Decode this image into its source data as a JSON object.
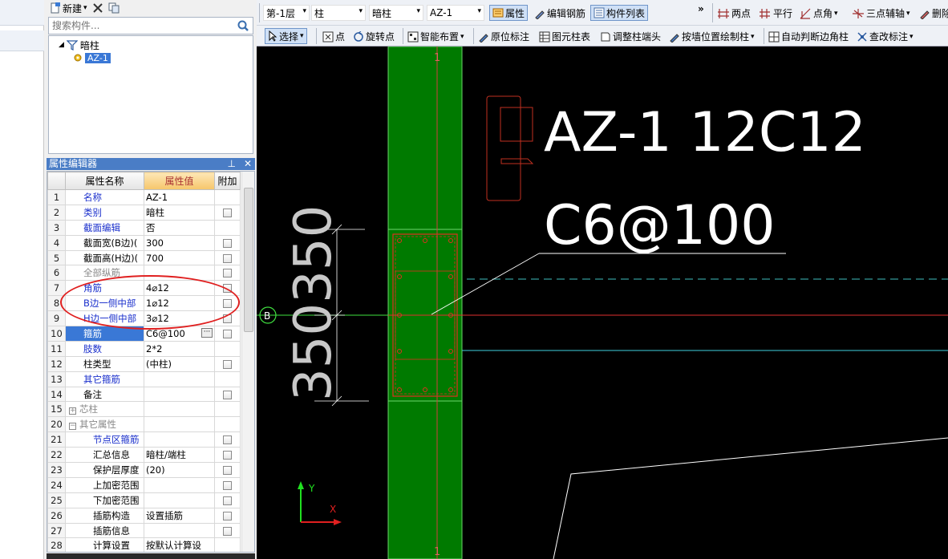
{
  "panel_toolbar": {
    "new_label": "新建",
    "new_arrow": "▾"
  },
  "search": {
    "placeholder": "搜索构件..."
  },
  "tree": {
    "root_label": "暗柱",
    "child_label": "AZ-1"
  },
  "prop_editor": {
    "title": "属性编辑器",
    "col_name": "属性名称",
    "col_value": "属性值",
    "col_extra": "附加",
    "rows": [
      {
        "num": "1",
        "name": "名称",
        "value": "AZ-1"
      },
      {
        "num": "2",
        "name": "类别",
        "value": "暗柱"
      },
      {
        "num": "3",
        "name": "截面编辑",
        "value": "否"
      },
      {
        "num": "4",
        "name": "截面宽(B边)(",
        "value": "300"
      },
      {
        "num": "5",
        "name": "截面高(H边)(",
        "value": "700"
      },
      {
        "num": "6",
        "name": "全部纵筋",
        "value": ""
      },
      {
        "num": "7",
        "name": "角筋",
        "value": "4⌀12"
      },
      {
        "num": "8",
        "name": "B边一侧中部",
        "value": "1⌀12"
      },
      {
        "num": "9",
        "name": "H边一侧中部",
        "value": "3⌀12"
      },
      {
        "num": "10",
        "name": "箍筋",
        "value": "C6@100"
      },
      {
        "num": "11",
        "name": "肢数",
        "value": "2*2"
      },
      {
        "num": "12",
        "name": "柱类型",
        "value": "(中柱)"
      },
      {
        "num": "13",
        "name": "其它箍筋",
        "value": ""
      },
      {
        "num": "14",
        "name": "备注",
        "value": ""
      },
      {
        "num": "15",
        "name": "芯柱",
        "value": ""
      },
      {
        "num": "20",
        "name": "其它属性",
        "value": ""
      },
      {
        "num": "21",
        "name": "节点区箍筋",
        "value": ""
      },
      {
        "num": "22",
        "name": "汇总信息",
        "value": "暗柱/端柱"
      },
      {
        "num": "23",
        "name": "保护层厚度",
        "value": "(20)"
      },
      {
        "num": "24",
        "name": "上加密范围",
        "value": ""
      },
      {
        "num": "25",
        "name": "下加密范围",
        "value": ""
      },
      {
        "num": "26",
        "name": "插筋构造",
        "value": "设置插筋"
      },
      {
        "num": "27",
        "name": "插筋信息",
        "value": ""
      },
      {
        "num": "28",
        "name": "计算设置",
        "value": "按默认计算设"
      }
    ]
  },
  "toolbar1": {
    "floor": "第-1层",
    "category": "柱",
    "subtype": "暗柱",
    "component": "AZ-1",
    "properties": "属性",
    "edit_rebar": "编辑钢筋",
    "component_list": "构件列表",
    "more": "»",
    "two_points": "两点",
    "parallel": "平行",
    "point_angle": "点角",
    "three_point_aux": "三点辅轴",
    "delete": "删除"
  },
  "toolbar2": {
    "select": "选择",
    "point": "点",
    "rotate_point": "旋转点",
    "smart_layout": "智能布置",
    "in_place_label": "原位标注",
    "column_table": "图元柱表",
    "adjust_column_end": "调整柱端头",
    "draw_by_wall": "按墙位置绘制柱",
    "auto_edge_column": "自动判断边角柱",
    "check_label": "查改标注"
  },
  "canvas": {
    "axis_top": "1",
    "axis_bottom": "1",
    "axis_b": "B",
    "label_main": "AZ-1 12C12",
    "label_stirrup": "C6@100",
    "dim_text": "350350",
    "y_label": "Y",
    "x_label": "X"
  },
  "colors": {
    "column_fill": "#007a00",
    "canvas_bg": "#000000",
    "rebar_red": "#e03020",
    "highlight_oval": "#e02020",
    "selected_row": "#3a78d6"
  }
}
